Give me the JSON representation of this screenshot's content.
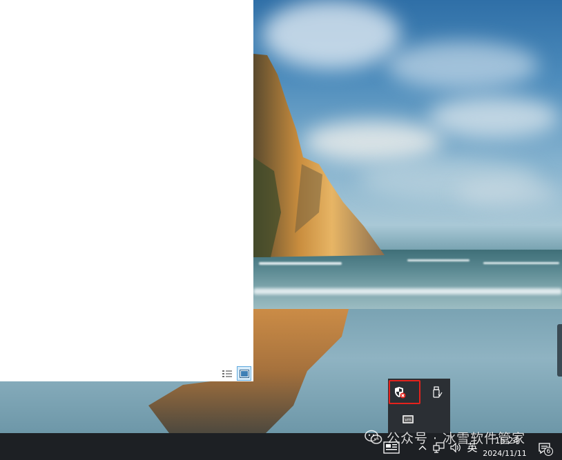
{
  "explorer": {
    "view_buttons": [
      {
        "name": "details-view-button",
        "icon": "details-view-icon",
        "active": false
      },
      {
        "name": "large-icons-view-button",
        "icon": "large-icons-view-icon",
        "active": true
      }
    ]
  },
  "tray_flyout": {
    "icons": [
      "windows-security-warning-icon",
      "usb-safely-remove-icon",
      "vmware-tray-icon"
    ],
    "highlighted": "windows-security-warning-icon",
    "highlight_color": "#e5221c"
  },
  "taskbar": {
    "icons": [
      "news-widget-icon",
      "chevron-up-icon",
      "network-icon",
      "volume-icon",
      "notification-icon"
    ],
    "ime_label": "英",
    "clock_time": "15:24",
    "clock_date": "2024/11/11",
    "notification_count": "6"
  },
  "watermark": {
    "logo": "wechat-logo-icon",
    "text": "公众号 · 冰雪软件管家"
  },
  "colors": {
    "taskbar_bg": "#1d2024",
    "flyout_bg": "#2b2f34",
    "accent_highlight": "#e5221c"
  }
}
